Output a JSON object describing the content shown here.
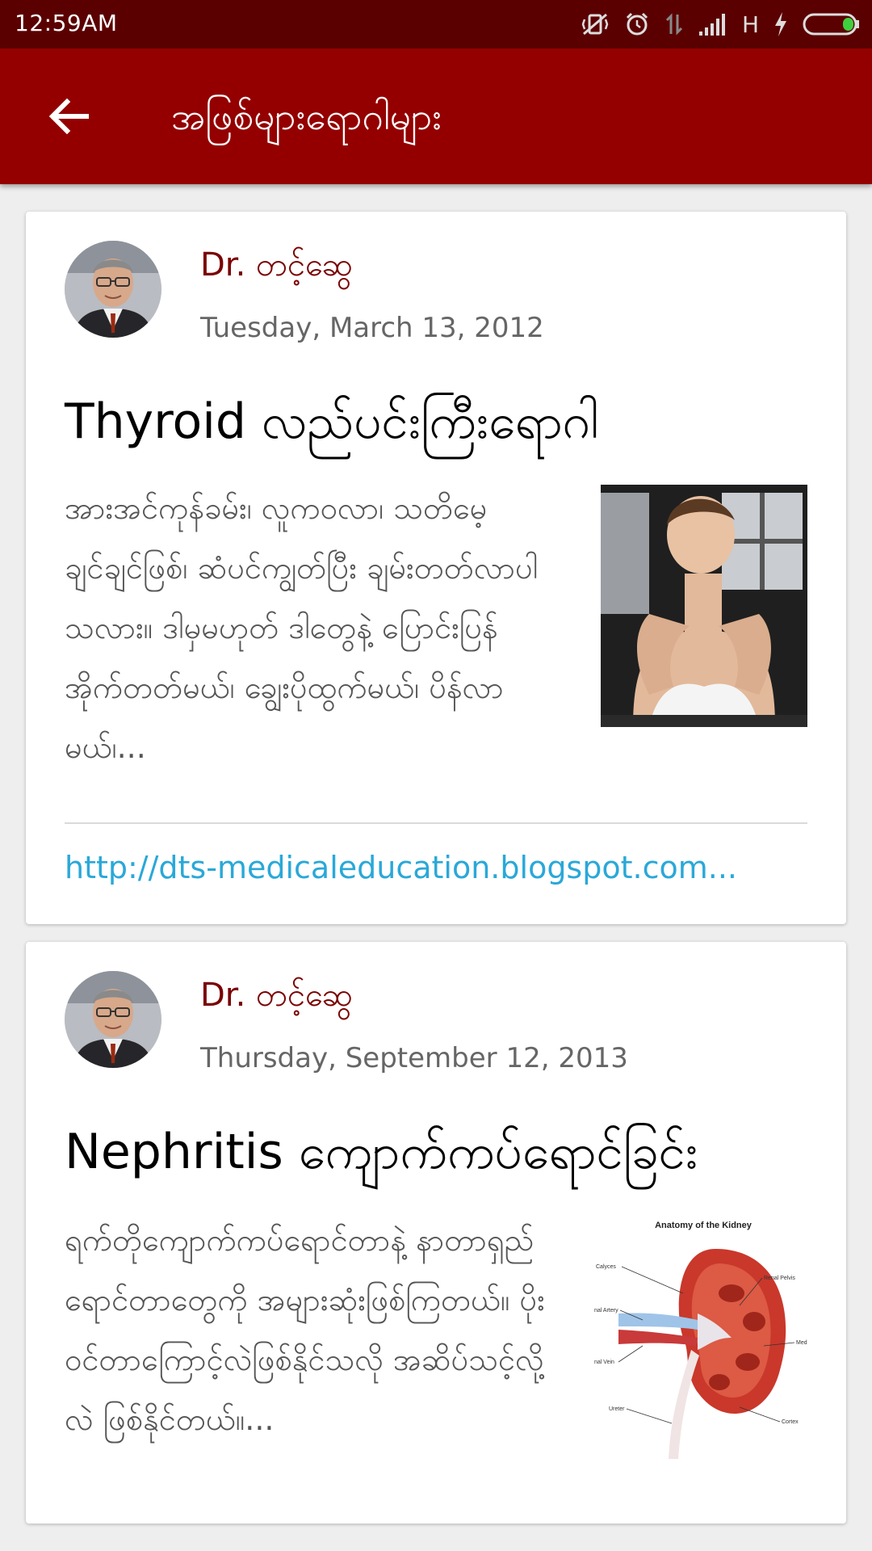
{
  "status_bar": {
    "time": "12:59AM",
    "network": "H",
    "icons": [
      "vibrate-off-icon",
      "alarm-icon",
      "data-transfer-icon",
      "signal-icon",
      "charging-icon",
      "battery-icon"
    ],
    "battery_color": "#3ecf3e"
  },
  "app_bar": {
    "title": "အဖြစ်များရောဂါများ",
    "back_icon": "arrow-left-icon",
    "color": "#940000"
  },
  "posts": [
    {
      "author": "Dr. တင့်ဆွေ",
      "date": "Tuesday, March 13, 2012",
      "title": "Thyroid လည်ပင်းကြီးရောဂါ",
      "excerpt": "အားအင်ကုန်ခမ်း၊ လူကဝလာ၊ သတိမေ့ချင်ချင်ဖြစ်၊ ဆံပင်ကျွတ်ပြီး ချမ်းတတ်လာပါသလား။ ဒါမှမဟုတ် ဒါတွေနဲ့ ပြောင်းပြန် အိုက်တတ်မယ်၊ ချွေးပိုထွက်မယ်၊ ပိန်လာမယ်၊...",
      "link": "http://dts-medicaleducation.blogspot.com..."
    },
    {
      "author": "Dr. တင့်ဆွေ",
      "date": "Thursday, September 12, 2013",
      "title": "Nephritis ကျောက်ကပ်ရောင်ခြင်း",
      "excerpt": "ရက်တိုကျောက်ကပ်ရောင်တာနဲ့ နာတာရှည်ရောင်တာတွေကို အများဆုံးဖြစ်ကြတယ်။ ပိုးဝင်တာကြောင့်လဲဖြစ်နိုင်သလို အဆိပ်သင့်လို့လဲ ဖြစ်နိုင်တယ်။...",
      "image": {
        "heading": "Anatomy of the Kidney",
        "labels": [
          "Calyces",
          "Renal Pelvis",
          "nal Artery",
          "Med",
          "nal Vein",
          "Ureter",
          "Cortex"
        ]
      }
    }
  ]
}
